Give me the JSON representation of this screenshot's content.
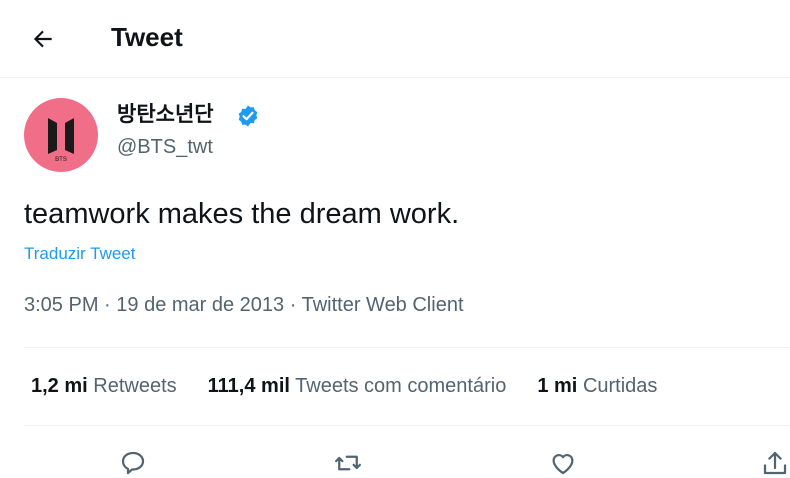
{
  "header": {
    "title": "Tweet",
    "back_icon": "arrow-left-icon"
  },
  "author": {
    "name": "방탄소년단",
    "handle": "@BTS_twt",
    "avatar_text": "BTS",
    "avatar_color": "#f06e88",
    "verified_color": "#1d9bf0"
  },
  "tweet": {
    "text": "teamwork makes the dream work.",
    "translate_label": "Traduzir Tweet",
    "time": "3:05 PM",
    "date": "19 de mar de 2013",
    "client": "Twitter Web Client",
    "separator": " · "
  },
  "stats": [
    {
      "count": "1,2 mi",
      "label": "Retweets"
    },
    {
      "count": "111,4 mil",
      "label": "Tweets com comentário"
    },
    {
      "count": "1 mi",
      "label": "Curtidas"
    }
  ],
  "actions": [
    "reply-icon",
    "retweet-icon",
    "like-icon",
    "share-icon"
  ]
}
